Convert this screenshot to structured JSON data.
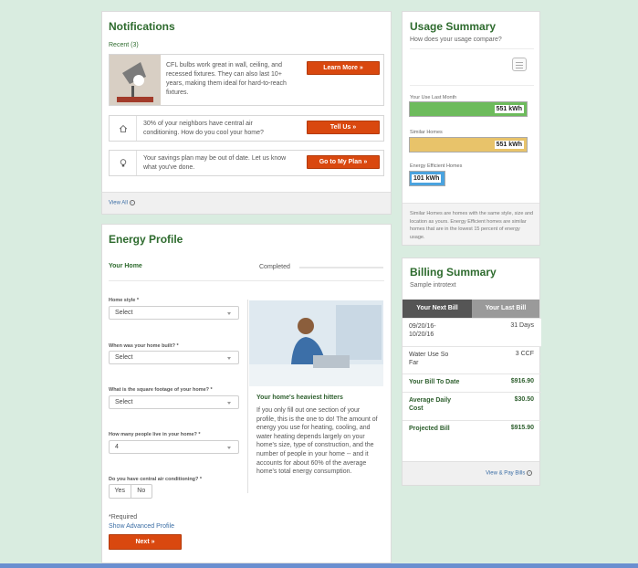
{
  "notifications": {
    "title": "Notifications",
    "recent_label": "Recent (3)",
    "items": [
      {
        "text": "CFL bulbs work great in wall, ceiling, and recessed fixtures. They can also last 10+ years, making them ideal for hard-to-reach fixtures.",
        "button": "Learn More »",
        "icon": "lamp-image"
      },
      {
        "text": "30% of your neighbors have central air conditioning. How do you cool your home?",
        "button": "Tell Us »",
        "icon": "home-icon"
      },
      {
        "text": "Your savings plan may be out of date. Let us know what you've done.",
        "button": "Go to My Plan »",
        "icon": "lightbulb-icon"
      }
    ],
    "view_all": "View All"
  },
  "energy_profile": {
    "title": "Energy Profile",
    "section": "Your Home",
    "status": "Completed",
    "fields": [
      {
        "label": "Home style *",
        "value": "Select"
      },
      {
        "label": "When was your home built? *",
        "value": "Select"
      },
      {
        "label": "What is the square footage of your home? *",
        "value": "Select"
      },
      {
        "label": "How many people live in your home? *",
        "value": "4"
      },
      {
        "label": "Do you have central air conditioning? *",
        "yes": "Yes",
        "no": "No"
      }
    ],
    "hitters_title": "Your home's heaviest hitters",
    "hitters_text": "If you only fill out one section of your profile, this is the one to do! The amount of energy you use for heating, cooling, and water heating depends largely on your home's size, type of construction, and the number of people in your home -- and it accounts for about 60% of the average home's total energy consumption.",
    "required": "*Required",
    "advanced": "Show Advanced Profile",
    "next": "Next »"
  },
  "usage_summary": {
    "title": "Usage Summary",
    "subtitle": "How does your usage compare?",
    "bars": [
      {
        "label": "Your Use Last Month",
        "value": "551 kWh",
        "amount": 551,
        "color": "#6dbb5c"
      },
      {
        "label": "Similar Homes",
        "value": "551 kWh",
        "amount": 551,
        "color": "#e8c36a"
      },
      {
        "label": "Energy Efficient Homes",
        "value": "101 kWh",
        "amount": 101,
        "color": "#4aa3df"
      }
    ],
    "footnote": "Similar Homes are homes with the same style, size and location as yours. Energy Efficient homes are similar homes that are in the lowest 15 percent of energy usage."
  },
  "billing_summary": {
    "title": "Billing Summary",
    "intro": "Sample introtext",
    "tab_next": "Your Next Bill",
    "tab_last": "Your Last Bill",
    "dates": "09/20/16-10/20/16",
    "days": "31 Days",
    "water_label": "Water Use So Far",
    "water_value": "3 CCF",
    "to_date_label": "Your Bill To Date",
    "to_date_value": "$916.90",
    "avg_label": "Average Daily Cost",
    "avg_value": "$30.50",
    "proj_label": "Projected Bill",
    "proj_value": "$915.90",
    "view_pay": "View & Pay Bills"
  }
}
